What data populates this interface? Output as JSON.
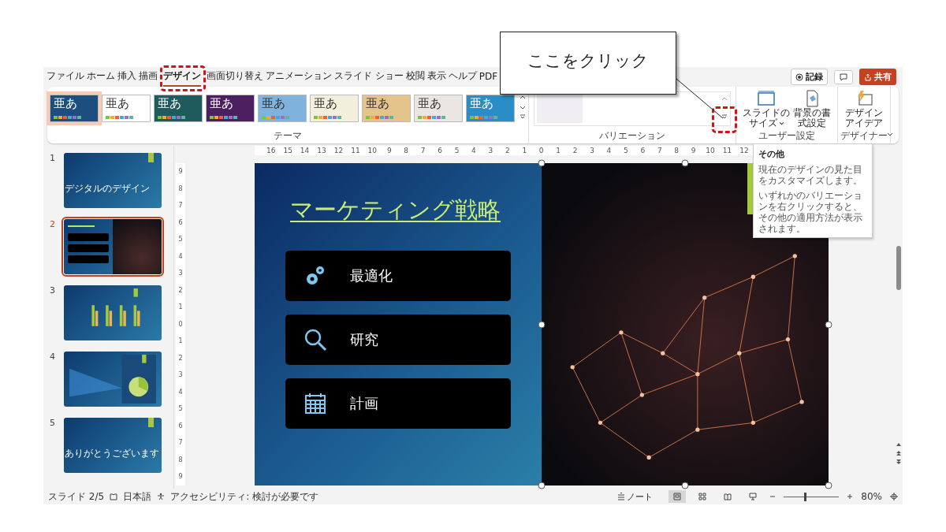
{
  "annotation": {
    "callout": "ここをクリック"
  },
  "ribbon": {
    "tabs": [
      {
        "label": "ファイル",
        "selected": false
      },
      {
        "label": "ホーム",
        "selected": false
      },
      {
        "label": "挿入",
        "selected": false
      },
      {
        "label": "描画",
        "selected": false
      },
      {
        "label": "デザイン",
        "selected": true
      },
      {
        "label": "画面切り替え",
        "selected": false
      },
      {
        "label": "アニメーション",
        "selected": false
      },
      {
        "label": "スライド ショー",
        "selected": false
      },
      {
        "label": "校閲",
        "selected": false
      },
      {
        "label": "表示",
        "selected": false
      },
      {
        "label": "ヘルプ",
        "selected": false
      },
      {
        "label": "PDF",
        "selected": false
      }
    ],
    "record_button": "記録",
    "share_button": "共有",
    "themes": {
      "group_label": "テーマ",
      "items": [
        {
          "label": "亜あ",
          "color": "#1c4f80",
          "selected": true
        },
        {
          "label": "亜あ",
          "color": "#ffffff",
          "selected": false
        },
        {
          "label": "亜あ",
          "color": "#1f5a5c",
          "selected": false
        },
        {
          "label": "亜あ",
          "color": "#4b1f60",
          "selected": false
        },
        {
          "label": "亜あ",
          "color": "#7fb2dc",
          "selected": false
        },
        {
          "label": "亜あ",
          "color": "#f2f0dc",
          "selected": false
        },
        {
          "label": "亜あ",
          "color": "#e5c48c",
          "selected": false
        },
        {
          "label": "亜あ",
          "color": "#ece6e2",
          "selected": false
        },
        {
          "label": "亜あ",
          "color": "#2a8dc5",
          "selected": false
        }
      ]
    },
    "variations": {
      "group_label": "バリエーション"
    },
    "customize": {
      "group_label": "ユーザー設定",
      "buttons": [
        {
          "kind": "size",
          "lines": [
            "スライドの",
            "サイズ"
          ]
        },
        {
          "kind": "background",
          "lines": [
            "背景の書",
            "式設定"
          ]
        }
      ]
    },
    "designer": {
      "group_label": "デザイナー",
      "button": {
        "lines": [
          "デザイン",
          "アイデア"
        ]
      }
    }
  },
  "tooltip": {
    "title": "その他",
    "paragraphs": [
      "現在のデザインの見た目をカスタマイズします。",
      "いずれかのバリエーションを右クリックすると、その他の適用方法が表示されます。"
    ]
  },
  "thumbnails": [
    {
      "number": "1",
      "selected": false,
      "kind": "title",
      "title": "デジタルのデザイン"
    },
    {
      "number": "2",
      "selected": true,
      "kind": "split"
    },
    {
      "number": "3",
      "selected": false,
      "kind": "chart"
    },
    {
      "number": "4",
      "selected": false,
      "kind": "pie"
    },
    {
      "number": "5",
      "selected": false,
      "kind": "title",
      "title": "ありがとうございます"
    }
  ],
  "rulers": {
    "horizontal": [
      "16",
      "15",
      "14",
      "13",
      "12",
      "11",
      "10",
      "9",
      "8",
      "7",
      "6",
      "5",
      "4",
      "3",
      "2",
      "1",
      "0",
      "1",
      "2",
      "3",
      "4",
      "5",
      "6",
      "7",
      "8",
      "9",
      "10",
      "11",
      "12"
    ],
    "vertical": [
      "9",
      "8",
      "7",
      "6",
      "5",
      "4",
      "3",
      "2",
      "1",
      "0",
      "1",
      "2",
      "3",
      "4",
      "5",
      "6",
      "7",
      "8",
      "9"
    ]
  },
  "slide": {
    "title": "マーケティング戦略",
    "items": [
      {
        "kind": "gear",
        "label": "最適化"
      },
      {
        "kind": "search",
        "label": "研究"
      },
      {
        "kind": "calendar",
        "label": "計画"
      }
    ]
  },
  "status_bar": {
    "slide_counter": "スライド 2/5",
    "language": "日本語",
    "accessibility": "アクセシビリティ: 検討が必要です",
    "notes": "ノート",
    "views": [
      {
        "kind": "normal",
        "selected": true
      },
      {
        "kind": "sorter",
        "selected": false
      },
      {
        "kind": "reading",
        "selected": false
      },
      {
        "kind": "show",
        "selected": false
      }
    ],
    "zoom": {
      "level": 0.37,
      "percent": "80%"
    }
  }
}
